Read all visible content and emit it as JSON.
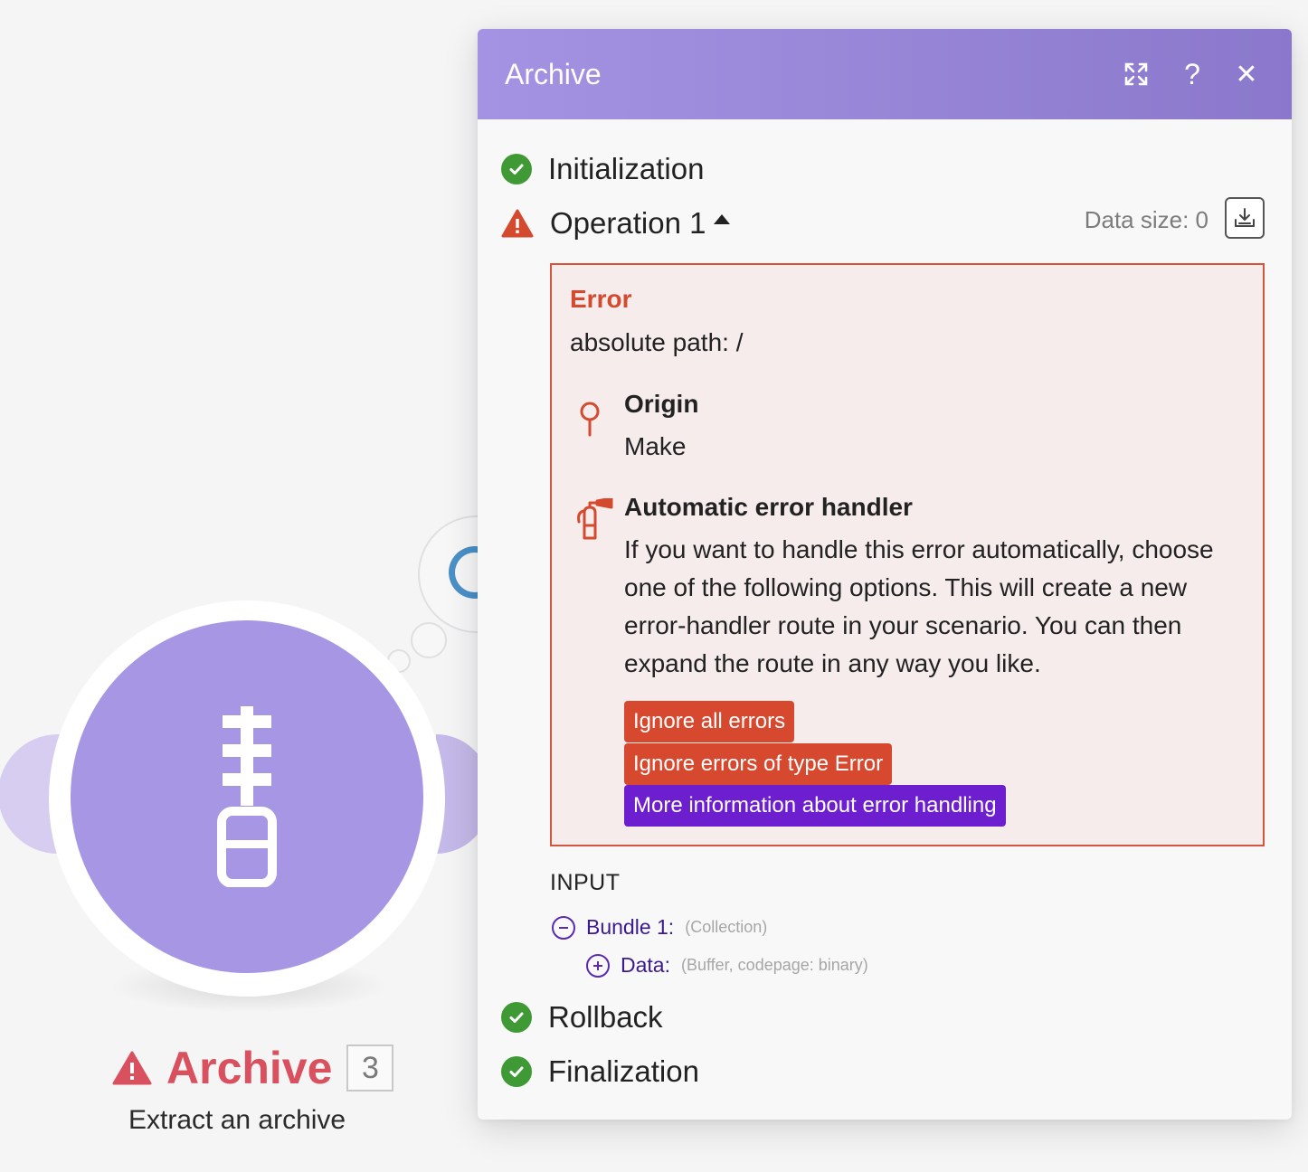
{
  "node": {
    "title": "Archive",
    "badge": "3",
    "subtitle": "Extract an archive",
    "icon": "zip-archive-icon",
    "color": "#a796e3",
    "status": "warning"
  },
  "dialog": {
    "title": "Archive",
    "header_buttons": [
      "expand-icon",
      "help-icon",
      "close-icon"
    ],
    "help_label": "?",
    "close_label": "✕",
    "steps": {
      "initialization": "Initialization",
      "operation": "Operation 1",
      "rollback": "Rollback",
      "finalization": "Finalization"
    },
    "data_size": "Data size: 0",
    "error": {
      "heading": "Error",
      "message": "absolute path: /",
      "origin_title": "Origin",
      "origin_value": "Make",
      "handler_title": "Automatic error handler",
      "handler_text": "If you want to handle this error automatically, choose one of the following options. This will create a new error-handler route in your scenario. You can then expand the route in any way you like.",
      "buttons": {
        "ignore_all": "Ignore all errors",
        "ignore_type": "Ignore errors of type Error",
        "more_info": "More information about error handling"
      }
    },
    "input": {
      "heading": "INPUT",
      "bundle_label": "Bundle 1:",
      "bundle_type": "(Collection)",
      "data_label": "Data:",
      "data_type": "(Buffer, codepage: binary)"
    }
  },
  "colors": {
    "header_start": "#a493e2",
    "header_end": "#8b78cc",
    "success": "#3f9a35",
    "error": "#d44a2e",
    "link_purple": "#6d1fd0"
  }
}
